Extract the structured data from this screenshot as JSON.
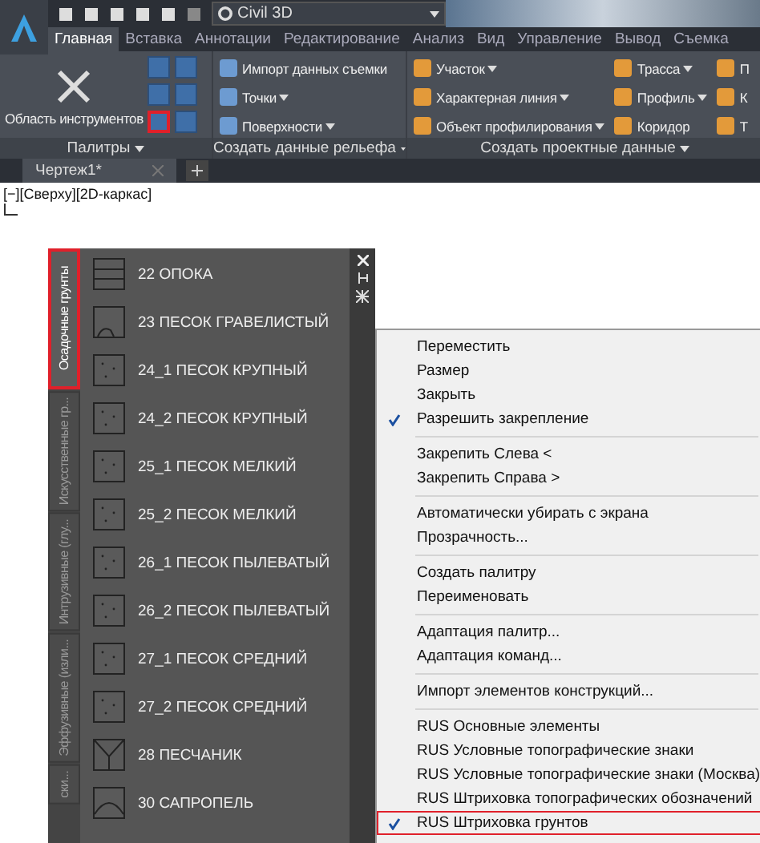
{
  "app": {
    "workspace": "Civil 3D"
  },
  "tabs": [
    {
      "label": "Главная",
      "selected": true
    },
    {
      "label": "Вставка",
      "selected": false
    },
    {
      "label": "Аннотации",
      "selected": false
    },
    {
      "label": "Редактирование",
      "selected": false
    },
    {
      "label": "Анализ",
      "selected": false
    },
    {
      "label": "Вид",
      "selected": false
    },
    {
      "label": "Управление",
      "selected": false
    },
    {
      "label": "Вывод",
      "selected": false
    },
    {
      "label": "Съемка",
      "selected": false
    }
  ],
  "ribbon": {
    "palettes_panel": {
      "big_button": "Область инструментов",
      "small_buttons": [
        {
          "highlighted": false
        },
        {
          "highlighted": false
        },
        {
          "highlighted": false
        },
        {
          "highlighted": false
        },
        {
          "highlighted": true
        },
        {
          "highlighted": false
        }
      ],
      "title": "Палитры"
    },
    "terrain_panel": {
      "buttons": [
        {
          "label": "Импорт данных съемки",
          "dropdown": false
        },
        {
          "label": "Точки",
          "dropdown": true
        },
        {
          "label": "Поверхности",
          "dropdown": true
        }
      ],
      "title": "Создать данные рельефа"
    },
    "design_panel": {
      "columns": [
        [
          {
            "label": "Участок",
            "dropdown": true
          },
          {
            "label": "Характерная линия",
            "dropdown": true
          },
          {
            "label": "Объект профилирования",
            "dropdown": true
          }
        ],
        [
          {
            "label": "Трасса",
            "dropdown": true
          },
          {
            "label": "Профиль",
            "dropdown": true
          },
          {
            "label": "Коридор",
            "dropdown": false
          }
        ],
        [
          {
            "label": "П",
            "dropdown": false
          },
          {
            "label": "К",
            "dropdown": false
          },
          {
            "label": "Т",
            "dropdown": false
          }
        ]
      ],
      "title": "Создать проектные данные"
    }
  },
  "document_tabs": [
    {
      "label": "Чертеж1*",
      "selected": true
    }
  ],
  "viewport": {
    "label": "[−][Сверху][2D-каркас]"
  },
  "palette": {
    "tabs": [
      {
        "label": "Осадочные грунты",
        "selected": true
      },
      {
        "label": "Искусственные гр...",
        "selected": false
      },
      {
        "label": "Интрузивные (глу...",
        "selected": false
      },
      {
        "label": "Эффузивные (изли...",
        "selected": false
      },
      {
        "label": "ски...",
        "selected": false
      }
    ],
    "items": [
      {
        "label": "22 ОПОКА",
        "kind": "lines"
      },
      {
        "label": "23 ПЕСОК ГРАВЕЛИСТЫЙ",
        "kind": "arc"
      },
      {
        "label": "24_1 ПЕСОК КРУПНЫЙ",
        "kind": "dots"
      },
      {
        "label": "24_2 ПЕСОК КРУПНЫЙ",
        "kind": "dots"
      },
      {
        "label": "25_1 ПЕСОК МЕЛКИЙ",
        "kind": "dots"
      },
      {
        "label": "25_2 ПЕСОК МЕЛКИЙ",
        "kind": "dots"
      },
      {
        "label": "26_1 ПЕСОК ПЫЛЕВАТЫЙ",
        "kind": "dots"
      },
      {
        "label": "26_2 ПЕСОК ПЫЛЕВАТЫЙ",
        "kind": "dots"
      },
      {
        "label": "27_1 ПЕСОК СРЕДНИЙ",
        "kind": "dots"
      },
      {
        "label": "27_2 ПЕСОК СРЕДНИЙ",
        "kind": "dots"
      },
      {
        "label": "28 ПЕСЧАНИК",
        "kind": "fork"
      },
      {
        "label": "30 САПРОПЕЛЬ",
        "kind": "dome"
      }
    ]
  },
  "context_menu": [
    [
      {
        "label": "Переместить",
        "checked": false,
        "highlighted": false
      },
      {
        "label": "Размер",
        "checked": false,
        "highlighted": false
      },
      {
        "label": "Закрыть",
        "checked": false,
        "highlighted": false
      },
      {
        "label": "Разрешить закрепление",
        "checked": true,
        "highlighted": false
      }
    ],
    [
      {
        "label": "Закрепить Слева <",
        "checked": false,
        "highlighted": false
      },
      {
        "label": "Закрепить Справа  >",
        "checked": false,
        "highlighted": false
      }
    ],
    [
      {
        "label": "Автоматически убирать с экрана",
        "checked": false,
        "highlighted": false
      },
      {
        "label": "Прозрачность...",
        "checked": false,
        "highlighted": false
      }
    ],
    [
      {
        "label": "Создать палитру",
        "checked": false,
        "highlighted": false
      },
      {
        "label": "Переименовать",
        "checked": false,
        "highlighted": false
      }
    ],
    [
      {
        "label": "Адаптация палитр...",
        "checked": false,
        "highlighted": false
      },
      {
        "label": "Адаптация команд...",
        "checked": false,
        "highlighted": false
      }
    ],
    [
      {
        "label": "Импорт элементов конструкций...",
        "checked": false,
        "highlighted": false
      }
    ],
    [
      {
        "label": "RUS Основные элементы",
        "checked": false,
        "highlighted": false
      },
      {
        "label": "RUS Условные топографические знаки",
        "checked": false,
        "highlighted": false
      },
      {
        "label": "RUS Условные топографические знаки (Москва)",
        "checked": false,
        "highlighted": false
      },
      {
        "label": "RUS Штриховка топографических обозначений",
        "checked": false,
        "highlighted": false
      },
      {
        "label": "RUS Штриховка грунтов",
        "checked": true,
        "highlighted": true
      }
    ]
  ]
}
